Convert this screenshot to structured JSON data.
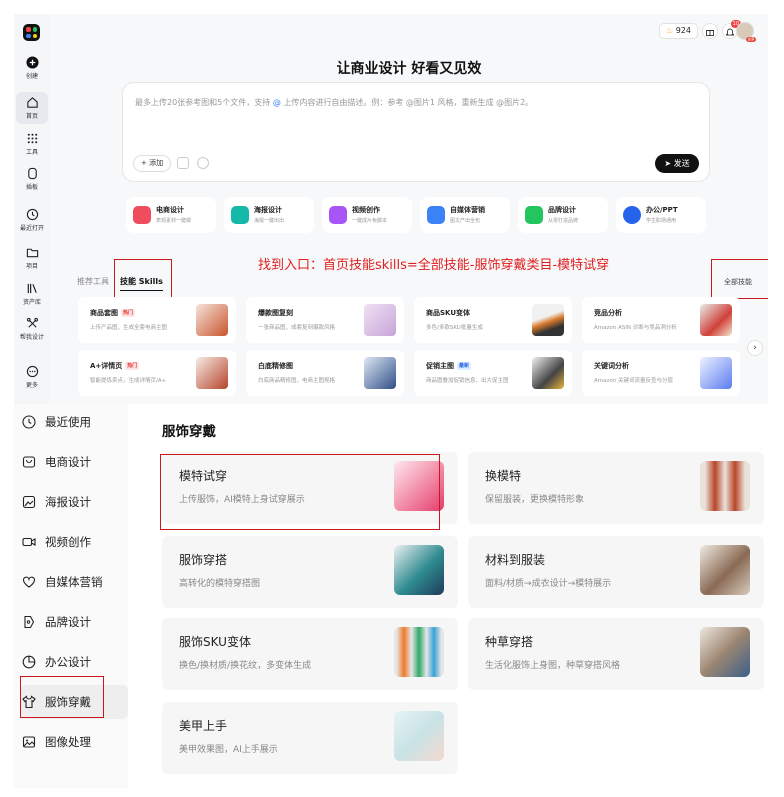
{
  "rail": {
    "items": [
      {
        "label": "创建",
        "icon": "plus-circle-icon"
      },
      {
        "label": "首页",
        "icon": "home-icon"
      },
      {
        "label": "工具",
        "icon": "grid-dots-icon"
      },
      {
        "label": "插板",
        "icon": "plugin-icon"
      },
      {
        "label": "最近打开",
        "icon": "clock-icon"
      },
      {
        "label": "项目",
        "icon": "folder-icon"
      },
      {
        "label": "资产库",
        "icon": "library-icon"
      },
      {
        "label": "帮我设计",
        "icon": "design-tools-icon"
      },
      {
        "label": "更多",
        "icon": "more-icon"
      }
    ]
  },
  "topbar": {
    "credits": "924",
    "notifications": "10",
    "vip": "VIP"
  },
  "hero": {
    "title": "让商业设计 好看又见效"
  },
  "prompt": {
    "placeholder_before": "最多上传20张参考图和5个文件，支持",
    "placeholder_at": "@",
    "placeholder_after": "上传内容进行自由描述。例：参考 @图片1 风格，重新生成 @图片2。",
    "add_label": "添加",
    "send_label": "发送"
  },
  "categories": [
    {
      "title": "电商设计",
      "sub": "表现素材一键做",
      "color": "#ef4c5e"
    },
    {
      "title": "海报设计",
      "sub": "海报一键出出",
      "color": "#14b8a6"
    },
    {
      "title": "视频创作",
      "sub": "一键成片免脚本",
      "color": "#a855f7"
    },
    {
      "title": "自媒体营销",
      "sub": "图文产出全包",
      "color": "#3b82f6"
    },
    {
      "title": "品牌设计",
      "sub": "从零打造品牌",
      "color": "#22c55e"
    },
    {
      "title": "办公/PPT",
      "sub": "学生职场通用",
      "color": "#2563eb"
    }
  ],
  "annotation": "找到入口：首页技能skills=全部技能-服饰穿戴类目-模特试穿",
  "tabs": {
    "recommended": "推荐工具",
    "skills": "技能 Skills",
    "all_skills": "全部技能"
  },
  "skills": [
    {
      "title": "商品套图",
      "badge": "热门",
      "badge_type": "hot",
      "sub": "上传产品图，生成全套电商主图"
    },
    {
      "title": "爆款图复刻",
      "badge": "",
      "badge_type": "",
      "sub": "一张商品图，成套复刻爆款风格"
    },
    {
      "title": "商品SKU变体",
      "badge": "",
      "badge_type": "",
      "sub": "多色/多款SKU批量生成"
    },
    {
      "title": "竞品分析",
      "badge": "",
      "badge_type": "",
      "sub": "Amazon ASIN 诊断与竞品洞分析"
    },
    {
      "title": "A+详情页",
      "badge": "热门",
      "badge_type": "hot",
      "sub": "智能提炼卖点，生成详情页/A+"
    },
    {
      "title": "白底精修图",
      "badge": "",
      "badge_type": "",
      "sub": "白底商品精修图，电商主图规格"
    },
    {
      "title": "促销主图",
      "badge": "最新",
      "badge_type": "new",
      "sub": "商品图叠加促销信息，出大促主图"
    },
    {
      "title": "关键词分析",
      "badge": "",
      "badge_type": "",
      "sub": "Amazon 关键词流量反查与分层"
    }
  ],
  "category_list": [
    {
      "label": "最近使用",
      "icon": "clock-icon"
    },
    {
      "label": "电商设计",
      "icon": "shop-icon"
    },
    {
      "label": "海报设计",
      "icon": "poster-icon"
    },
    {
      "label": "视频创作",
      "icon": "video-icon"
    },
    {
      "label": "自媒体营销",
      "icon": "heart-icon"
    },
    {
      "label": "品牌设计",
      "icon": "brand-icon"
    },
    {
      "label": "办公设计",
      "icon": "pie-chart-icon"
    },
    {
      "label": "服饰穿戴",
      "icon": "tshirt-icon"
    },
    {
      "label": "图像处理",
      "icon": "image-icon"
    }
  ],
  "panel": {
    "title": "服饰穿戴",
    "cards": [
      {
        "title": "模特试穿",
        "sub": "上传服饰，AI模特上身试穿展示"
      },
      {
        "title": "换模特",
        "sub": "保留服装，更换模特形象"
      },
      {
        "title": "服饰穿搭",
        "sub": "高转化的模特穿搭图"
      },
      {
        "title": "材料到服装",
        "sub": "面料/材质→成衣设计→模特展示"
      },
      {
        "title": "服饰SKU变体",
        "sub": "换色/换材质/换花纹，多变体生成"
      },
      {
        "title": "种草穿搭",
        "sub": "生活化服饰上身图，种草穿搭风格"
      },
      {
        "title": "美甲上手",
        "sub": "美甲效果图，AI上手展示"
      }
    ]
  }
}
